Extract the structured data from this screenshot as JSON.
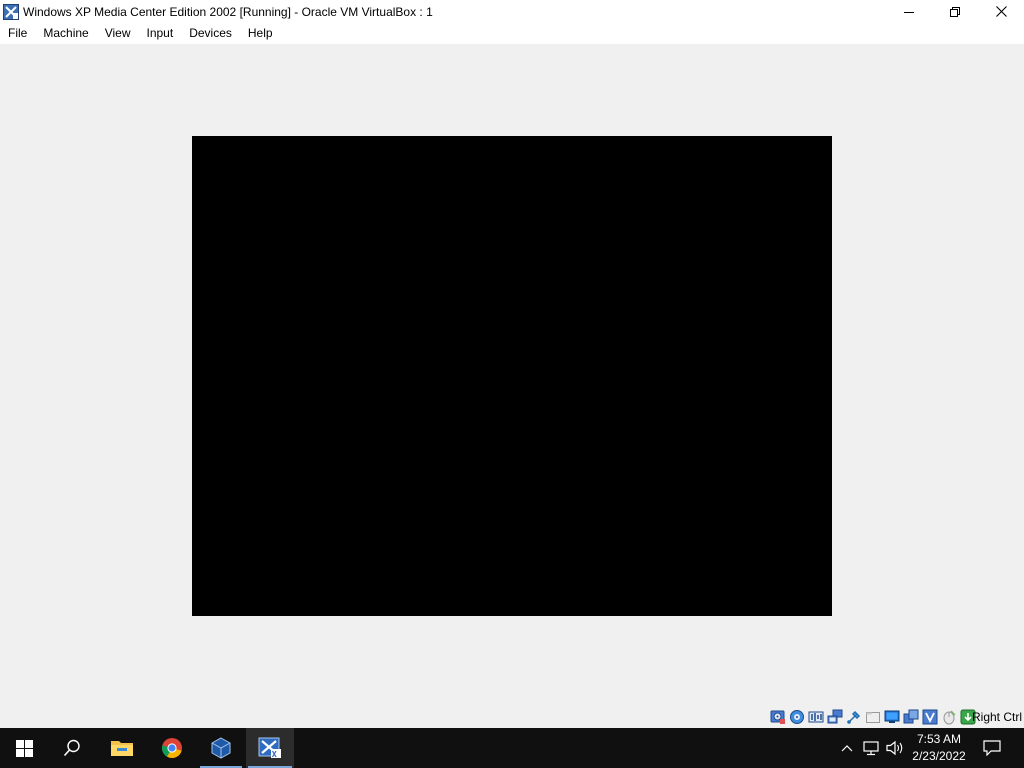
{
  "window": {
    "title": "Windows XP Media Center Edition 2002 [Running] - Oracle VM VirtualBox : 1",
    "icon": "virtualbox-vm-icon"
  },
  "menubar": {
    "items": [
      "File",
      "Machine",
      "View",
      "Input",
      "Devices",
      "Help"
    ]
  },
  "statusbar": {
    "icons": [
      "hard-disk-icon",
      "optical-drive-icon",
      "audio-icon",
      "network-icon",
      "usb-icon",
      "shared-folders-icon",
      "display-icon",
      "video-capture-icon",
      "virtualization-icon",
      "mouse-integration-icon",
      "keyboard-icon"
    ],
    "host_key": "Right Ctrl"
  },
  "taskbar": {
    "apps": [
      "windows-start-icon",
      "search-icon",
      "file-explorer-icon",
      "chrome-icon",
      "virtualbox-icon",
      "windows-xp-vm-icon"
    ],
    "tray_icons": [
      "chevron-up-icon",
      "network-icon",
      "volume-icon",
      "notification-icon"
    ],
    "clock": {
      "time": "7:53 AM",
      "date": "2/23/2022"
    }
  },
  "colors": {
    "taskbar": "#101010",
    "chrome": "#f0f0f0",
    "vm_screen": "#000000"
  }
}
